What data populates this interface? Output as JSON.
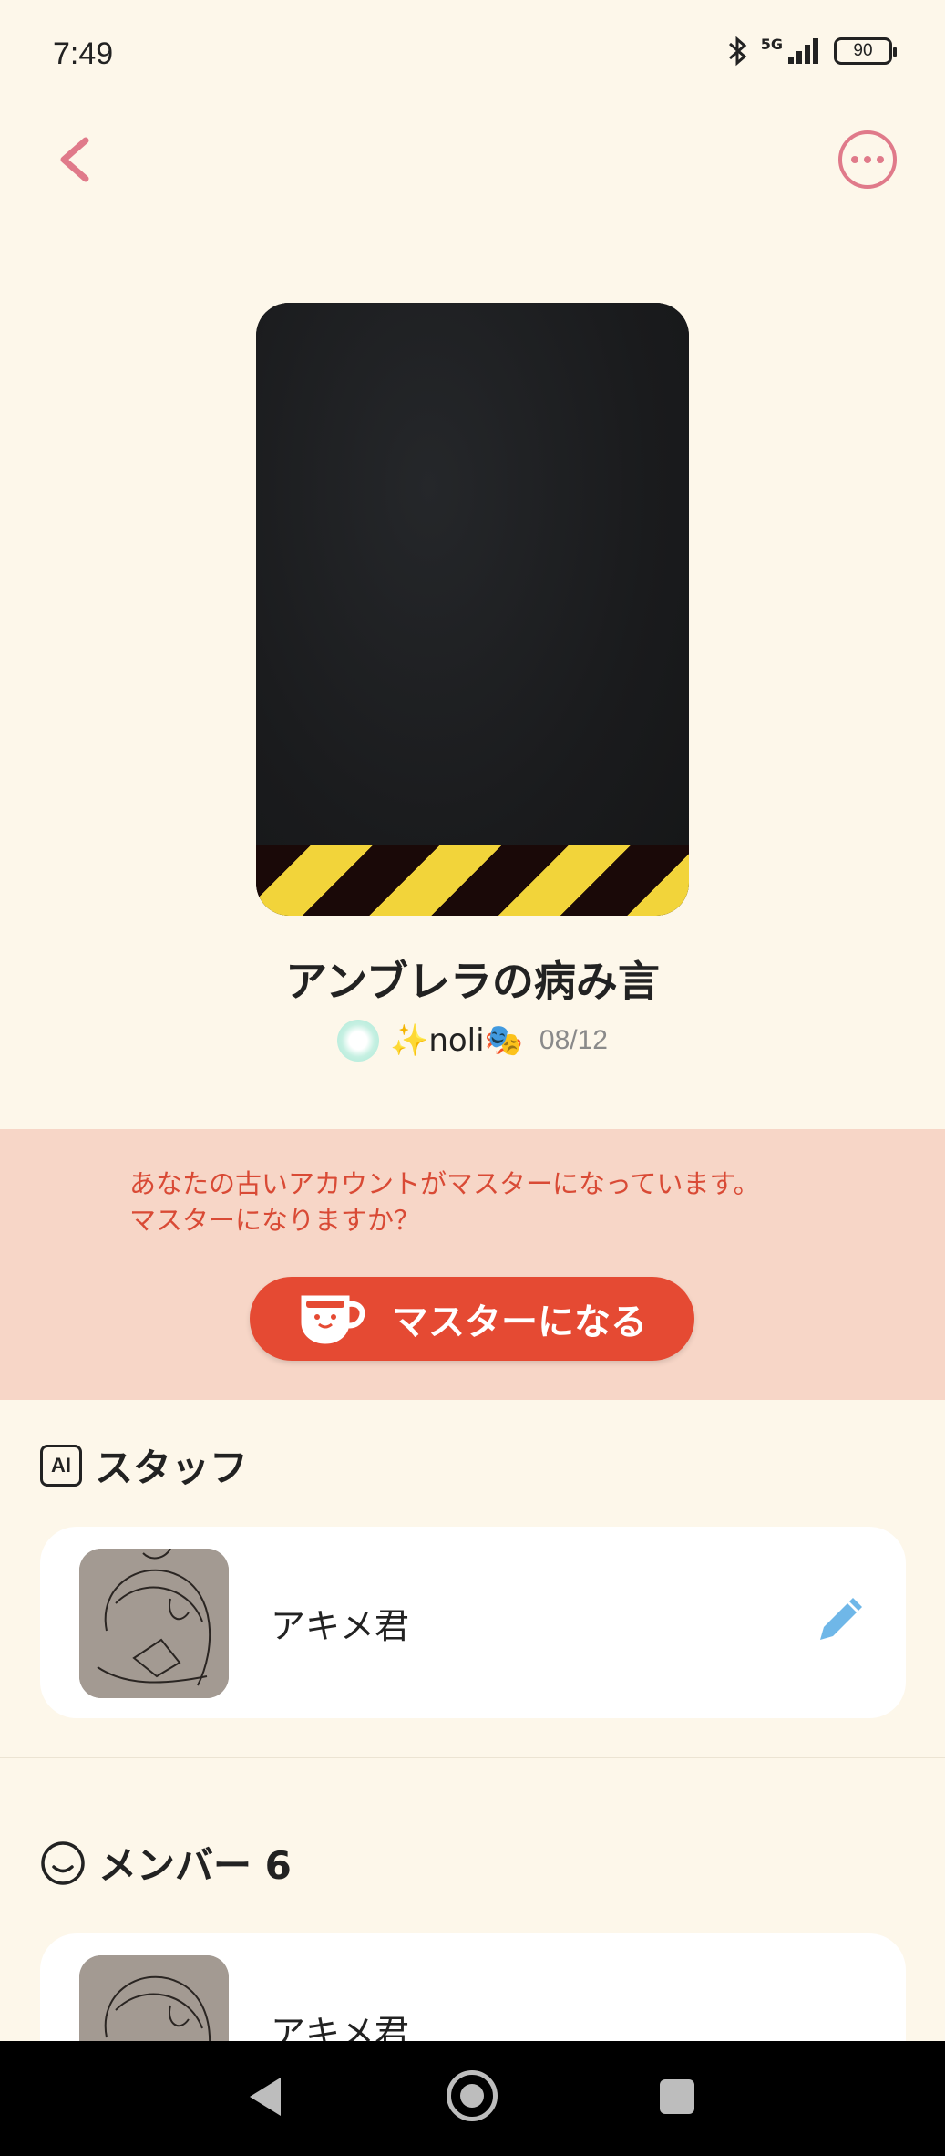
{
  "status_bar": {
    "time": "7:49",
    "network": "5G",
    "battery": "90",
    "icons": [
      "bluetooth-icon",
      "signal-icon",
      "battery-icon"
    ]
  },
  "header": {
    "back_icon": "chevron-left-icon",
    "more_icon": "more-dots-icon",
    "accent_color": "#e07a8a"
  },
  "room": {
    "title": "アンブレラの病み言",
    "owner_name": "✨noli🎭",
    "date": "08/12"
  },
  "notice": {
    "line1": "あなたの古いアカウントがマスターになっています。",
    "line2": "マスターになりますか？",
    "button_label": "マスターになる",
    "button_icon": "cup-icon",
    "button_color": "#e54a33",
    "text_color": "#d94a35",
    "background": "#f7d6c7"
  },
  "staff": {
    "heading": "スタッフ",
    "icon": "ai-icon",
    "icon_text": "AI",
    "members": [
      {
        "name": "アキメ君",
        "action_icon": "pencil-icon"
      }
    ]
  },
  "members": {
    "heading": "メンバー 6",
    "icon": "smile-icon",
    "members": [
      {
        "name": "アキメ君"
      }
    ]
  },
  "nav": {
    "back": "nav-back-icon",
    "home": "nav-home-icon",
    "recent": "nav-recent-icon"
  }
}
